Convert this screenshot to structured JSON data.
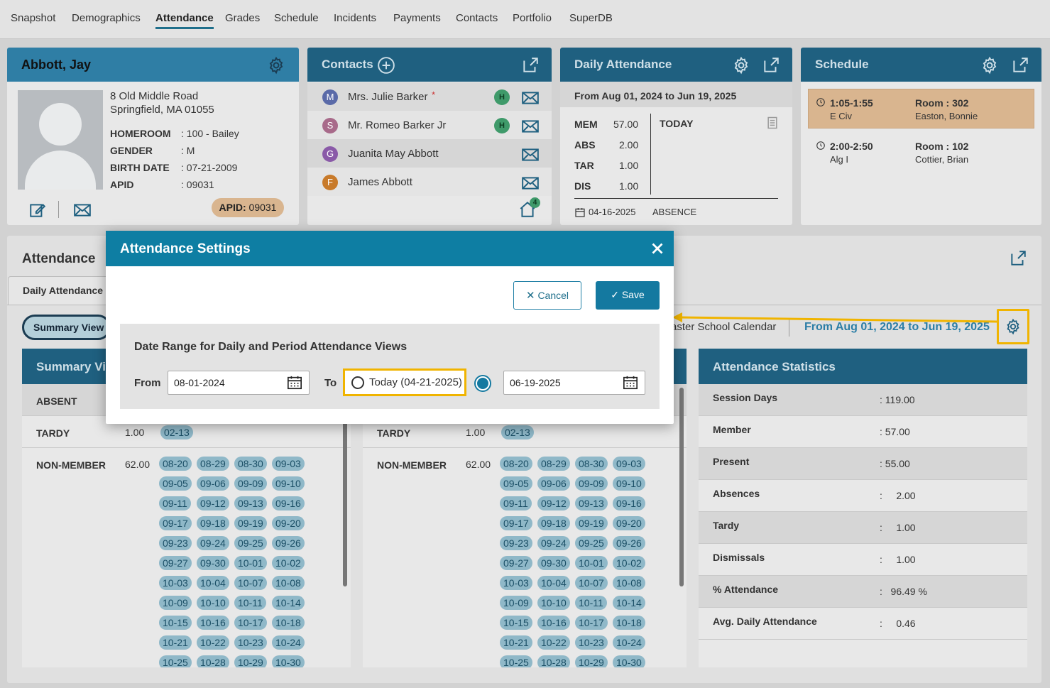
{
  "nav": {
    "tabs": [
      "Snapshot",
      "Demographics",
      "Attendance",
      "Grades",
      "Schedule",
      "Incidents",
      "Payments",
      "Contacts",
      "Portfolio",
      "SuperDB"
    ],
    "active": "Attendance"
  },
  "student": {
    "name": "Abbott, Jay",
    "address1": "8 Old Middle Road",
    "address2": "Springfield, MA 01055",
    "fields": [
      {
        "label": "HOMEROOM",
        "value": ": 100 - Bailey"
      },
      {
        "label": "GENDER",
        "value": ": M"
      },
      {
        "label": "BIRTH DATE",
        "value": ": 07-21-2009"
      },
      {
        "label": "APID",
        "value": ": 09031"
      }
    ],
    "apid_badge_label": "APID:",
    "apid_badge_value": "09031"
  },
  "contacts": {
    "title": "Contacts",
    "items": [
      {
        "initial": "M",
        "name": "Mrs. Julie Barker",
        "required": "*",
        "badge": "H",
        "color": "#5a6aa8"
      },
      {
        "initial": "S",
        "name": "Mr. Romeo Barker Jr",
        "required": "",
        "badge": "H",
        "color": "#a86a8a"
      },
      {
        "initial": "G",
        "name": "Juanita May Abbott",
        "required": "",
        "badge": "",
        "color": "#8a5aa8"
      },
      {
        "initial": "F",
        "name": "James Abbott",
        "required": "",
        "badge": "",
        "color": "#c87a2a"
      }
    ],
    "home_count": "4"
  },
  "daily": {
    "title": "Daily Attendance",
    "range": "From Aug 01, 2024 to Jun 19, 2025",
    "stats": [
      {
        "k": "MEM",
        "v": "57.00"
      },
      {
        "k": "ABS",
        "v": "2.00"
      },
      {
        "k": "TAR",
        "v": "1.00"
      },
      {
        "k": "DIS",
        "v": "1.00"
      }
    ],
    "today_label": "TODAY",
    "event_date": "04-16-2025",
    "event_type": "ABSENCE"
  },
  "schedule": {
    "title": "Schedule",
    "items": [
      {
        "time": "1:05-1:55",
        "course": "E Civ",
        "room": "Room : 302",
        "teacher": "Easton, Bonnie"
      },
      {
        "time": "2:00-2:50",
        "course": "Alg I",
        "room": "Room : 102",
        "teacher": "Cottier, Brian"
      }
    ]
  },
  "attendance": {
    "title": "Attendance",
    "tab": "Daily Attendance",
    "view_button": "Summary View",
    "calendar_label": "aster School Calendar",
    "range": "From Aug 01, 2024 to Jun 19, 2025",
    "summary_title": "Summary Vi",
    "absent_label": "ABSENT",
    "tardy_label": "TARDY",
    "tardy_value": "1.00",
    "tardy_dates": [
      "02-13"
    ],
    "nonmember_label": "NON-MEMBER",
    "nonmember_value": "62.00",
    "nonmember_dates": [
      "08-20",
      "08-29",
      "08-30",
      "09-03",
      "09-05",
      "09-06",
      "09-09",
      "09-10",
      "09-11",
      "09-12",
      "09-13",
      "09-16",
      "09-17",
      "09-18",
      "09-19",
      "09-20",
      "09-23",
      "09-24",
      "09-25",
      "09-26",
      "09-27",
      "09-30",
      "10-01",
      "10-02",
      "10-03",
      "10-04",
      "10-07",
      "10-08",
      "10-09",
      "10-10",
      "10-11",
      "10-14",
      "10-15",
      "10-16",
      "10-17",
      "10-18",
      "10-21",
      "10-22",
      "10-23",
      "10-24",
      "10-25",
      "10-28",
      "10-29",
      "10-30"
    ]
  },
  "stats": {
    "title": "Attendance Statistics",
    "rows": [
      {
        "k": "Session Days",
        "v": ": 119.00"
      },
      {
        "k": "Member",
        "v": ": 57.00"
      },
      {
        "k": "Present",
        "v": ": 55.00"
      },
      {
        "k": "Absences",
        "v": ":     2.00"
      },
      {
        "k": "Tardy",
        "v": ":     1.00"
      },
      {
        "k": "Dismissals",
        "v": ":     1.00"
      },
      {
        "k": "% Attendance",
        "v": ":   96.49 %"
      },
      {
        "k": "Avg. Daily Attendance",
        "v": ":     0.46"
      }
    ]
  },
  "modal": {
    "title": "Attendance Settings",
    "cancel": "Cancel",
    "save": "Save",
    "section_title": "Date Range for Daily and Period Attendance Views",
    "from_label": "From",
    "from_value": "08-01-2024",
    "to_label": "To",
    "today_option": "Today (04-21-2025)",
    "to_value": "06-19-2025"
  },
  "colors": {
    "header": "#1f6080",
    "modal_header": "#0e7ea3",
    "highlight": "#f0b400",
    "chip": "#8fb8c8"
  }
}
